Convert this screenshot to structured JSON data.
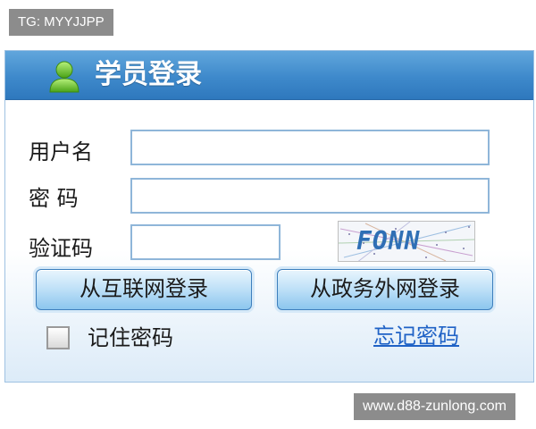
{
  "watermark_top": "TG: MYYJJPP",
  "watermark_bottom": "www.d88-zunlong.com",
  "login": {
    "title": "学员登录",
    "title_icon": "user-icon",
    "username_label": "用户名",
    "password_label": "密 码",
    "captcha_label": "验证码",
    "username_value": "",
    "password_value": "",
    "captcha_value": "",
    "captcha_text": "FONN",
    "internet_login_button": "从互联网登录",
    "gov_login_button": "从政务外网登录",
    "remember_label": "记住密码",
    "remember_checked": false,
    "forgot_link": "忘记密码"
  },
  "colors": {
    "header": "#3e89cb",
    "link": "#1f62c6",
    "button": "#c2e2f8",
    "field_border": "#8fb6d9"
  }
}
